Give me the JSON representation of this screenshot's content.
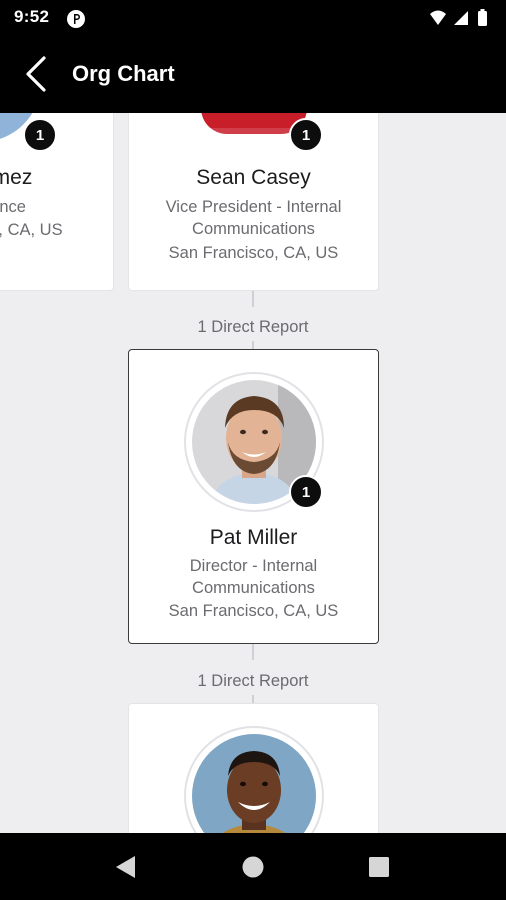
{
  "status_bar": {
    "time": "9:52",
    "icons": [
      "app-notification-icon",
      "wifi-icon",
      "signal-icon",
      "battery-icon"
    ]
  },
  "app_bar": {
    "title": "Org Chart",
    "back_icon": "back-arrow-icon"
  },
  "peers": [
    {
      "name_partial": "omez",
      "title_partial": "nance",
      "location_partial": "co, CA, US",
      "direct_report_count": "1"
    },
    {
      "name": "Sean Casey",
      "title_line1": "Vice President - Internal",
      "title_line2": "Communications",
      "location": "San Francisco, CA, US",
      "direct_report_count": "1"
    }
  ],
  "connector_1": {
    "label": "1 Direct Report"
  },
  "selected": {
    "name": "Pat Miller",
    "title_line1": "Director - Internal",
    "title_line2": "Communications",
    "location": "San Francisco, CA, US",
    "direct_report_count": "1"
  },
  "connector_2": {
    "label": "1 Direct Report"
  },
  "report": {
    "avatar": "avatar-photo"
  },
  "nav_bar": {
    "icons": [
      "nav-back-icon",
      "nav-home-icon",
      "nav-recents-icon"
    ]
  },
  "colors": {
    "bars": "#000000",
    "content_bg": "#eeeef0",
    "card_bg": "#ffffff",
    "badge": "#0d0d0d",
    "secondary_text": "#6b6b70",
    "selected_border": "#3a3a3a"
  }
}
